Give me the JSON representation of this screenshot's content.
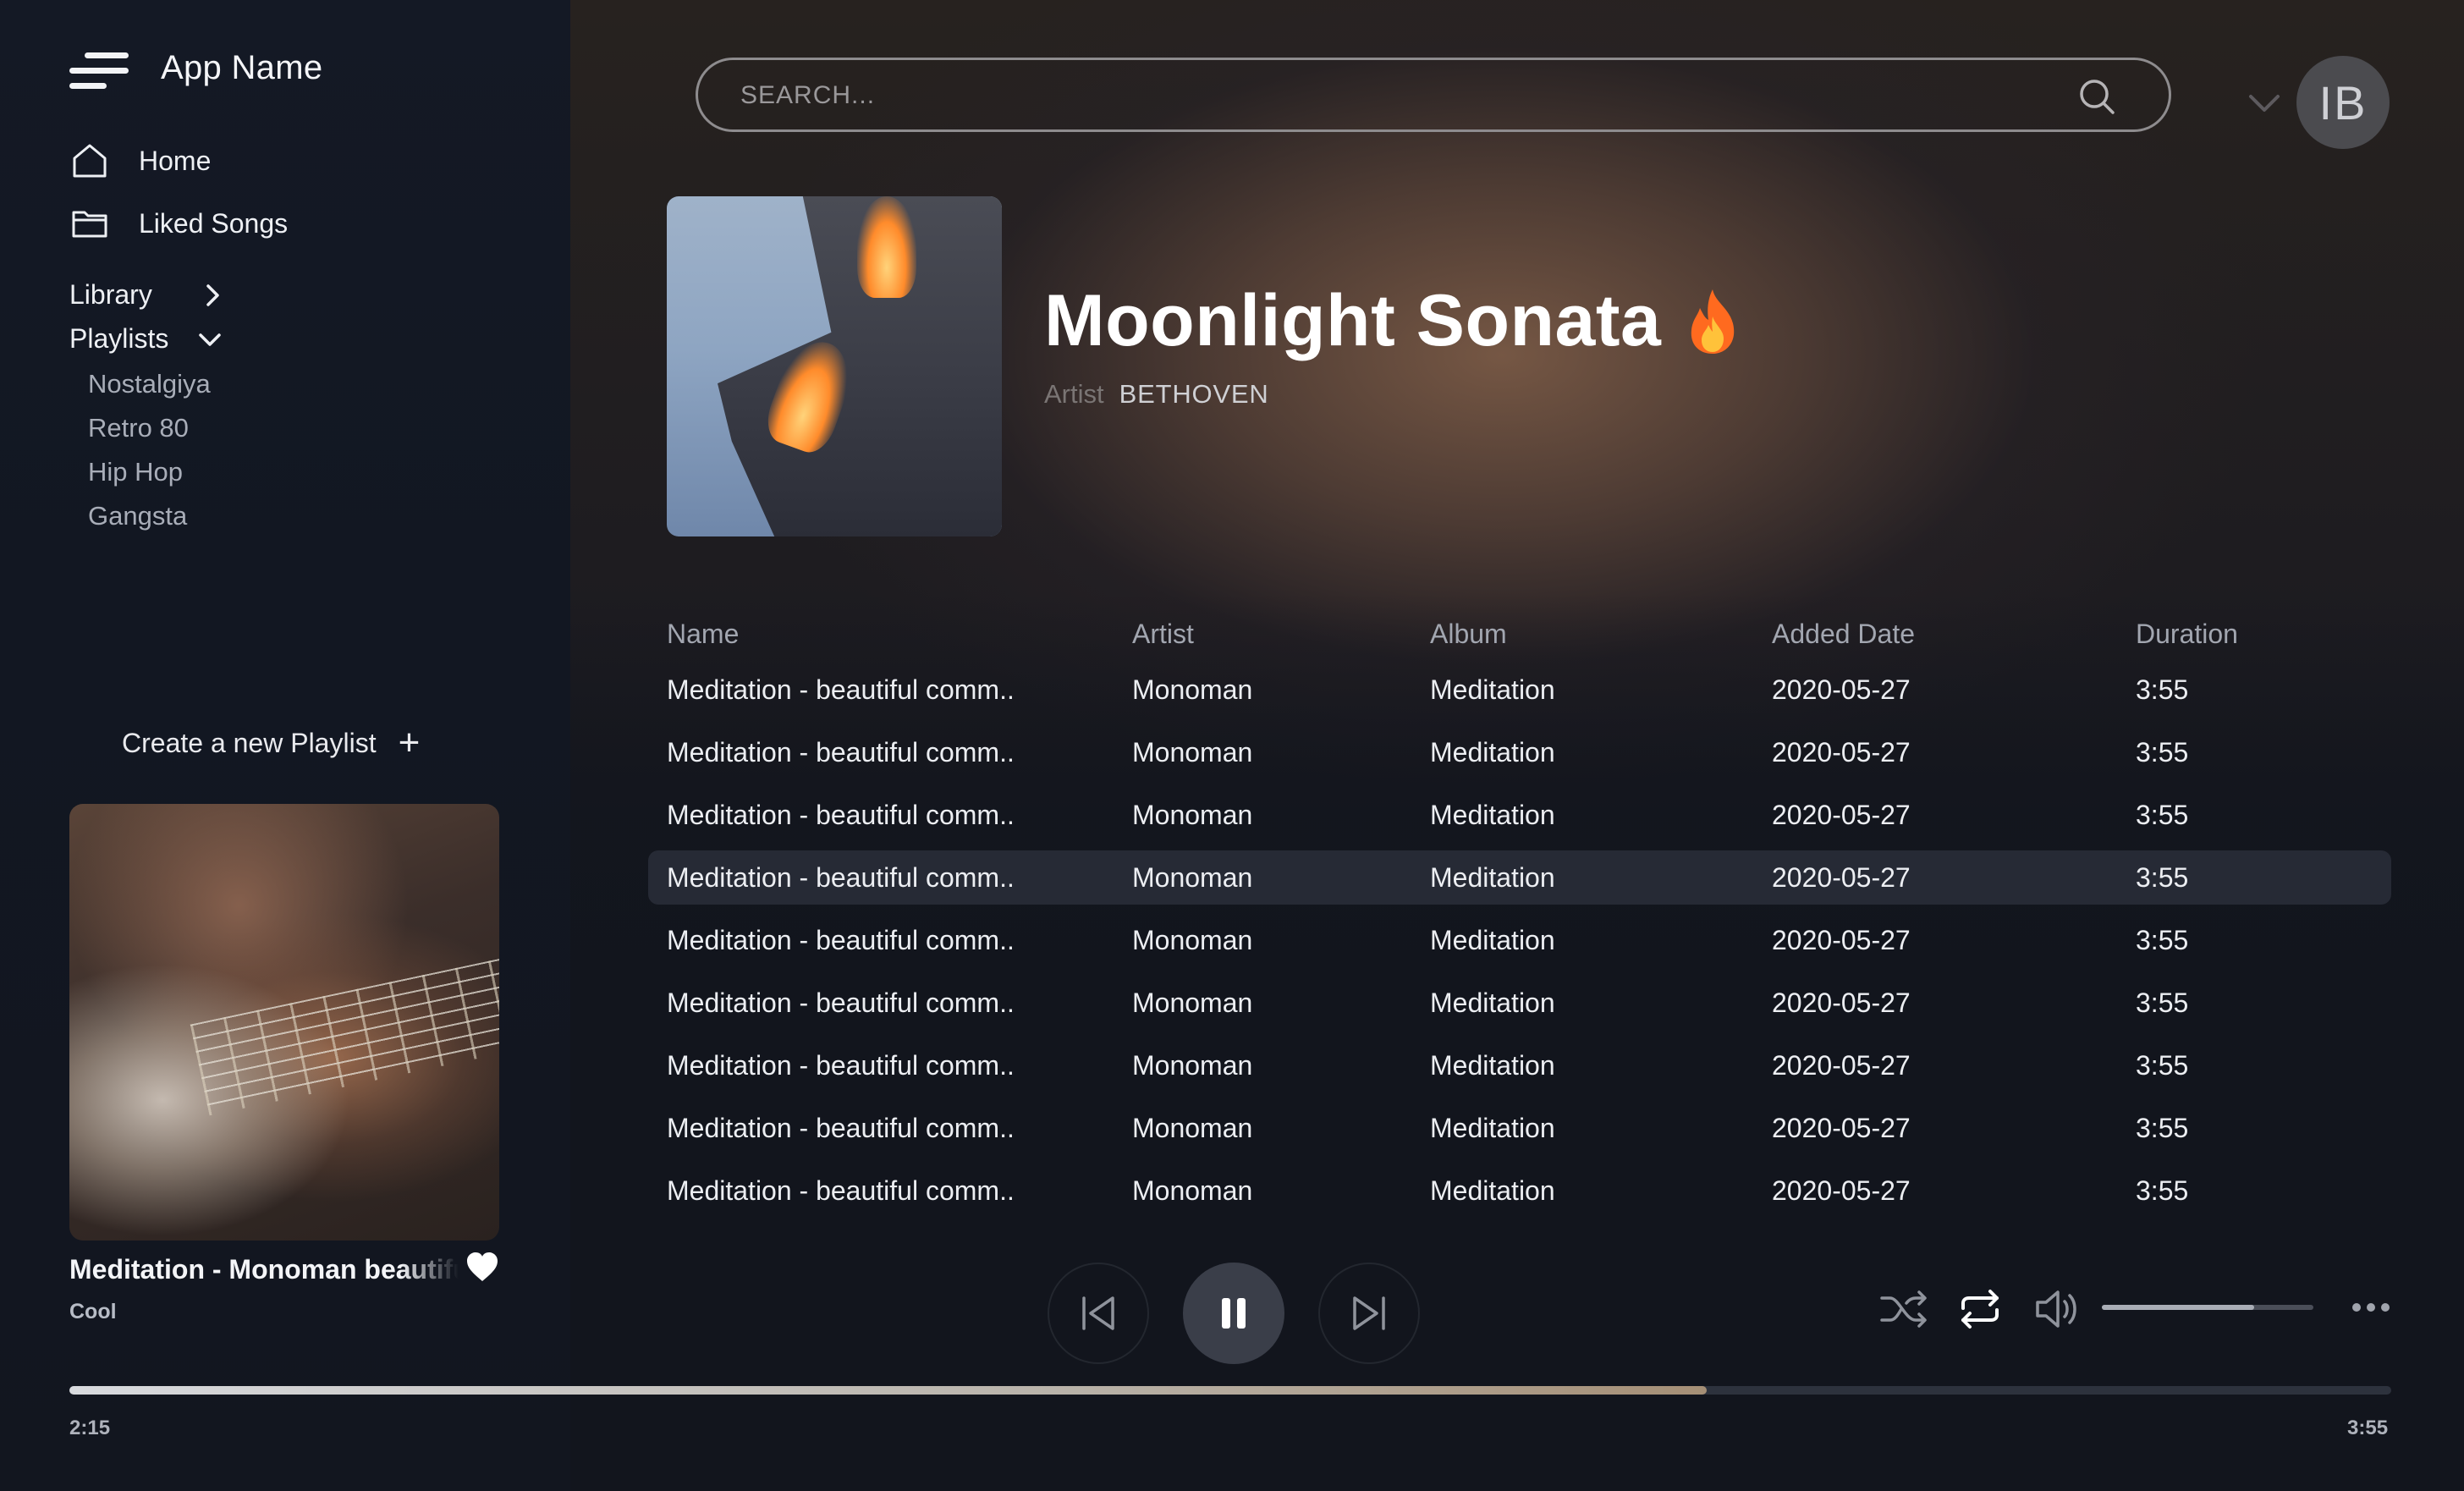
{
  "app": {
    "name": "App Name"
  },
  "sidebar": {
    "nav": [
      {
        "label": "Home",
        "icon": "home-icon"
      },
      {
        "label": "Liked Songs",
        "icon": "folder-icon"
      }
    ],
    "library_label": "Library",
    "playlists_label": "Playlists",
    "playlists": [
      "Nostalgiya",
      "Retro 80",
      "Hip Hop",
      "Gangsta"
    ],
    "create_label": "Create a new Playlist",
    "create_icon": "+"
  },
  "header": {
    "search_placeholder": "SEARCH...",
    "avatar_initials": "IB"
  },
  "hero": {
    "title": "Moonlight Sonata",
    "artist_label": "Artist",
    "artist": "BETHOVEN"
  },
  "table": {
    "columns": [
      "Name",
      "Artist",
      "Album",
      "Added Date",
      "Duration"
    ],
    "rows": [
      [
        "Meditation - beautiful comm..",
        "Monoman",
        "Meditation",
        "2020-05-27",
        "3:55"
      ],
      [
        "Meditation - beautiful comm..",
        "Monoman",
        "Meditation",
        "2020-05-27",
        "3:55"
      ],
      [
        "Meditation - beautiful comm..",
        "Monoman",
        "Meditation",
        "2020-05-27",
        "3:55"
      ],
      [
        "Meditation - beautiful comm..",
        "Monoman",
        "Meditation",
        "2020-05-27",
        "3:55"
      ],
      [
        "Meditation - beautiful comm..",
        "Monoman",
        "Meditation",
        "2020-05-27",
        "3:55"
      ],
      [
        "Meditation - beautiful comm..",
        "Monoman",
        "Meditation",
        "2020-05-27",
        "3:55"
      ],
      [
        "Meditation - beautiful comm..",
        "Monoman",
        "Meditation",
        "2020-05-27",
        "3:55"
      ],
      [
        "Meditation - beautiful comm..",
        "Monoman",
        "Meditation",
        "2020-05-27",
        "3:55"
      ],
      [
        "Meditation - beautiful comm..",
        "Monoman",
        "Meditation",
        "2020-05-27",
        "3:55"
      ]
    ],
    "active_row": 3
  },
  "now_playing": {
    "title": "Meditation - Monoman beautiful",
    "subtitle": "Cool",
    "elapsed": "2:15",
    "duration": "3:55",
    "progress": 0.705,
    "volume": 0.72
  },
  "colors": {
    "accent": "#3a3e49",
    "background": "#11141d",
    "active_row": "#262a35"
  }
}
